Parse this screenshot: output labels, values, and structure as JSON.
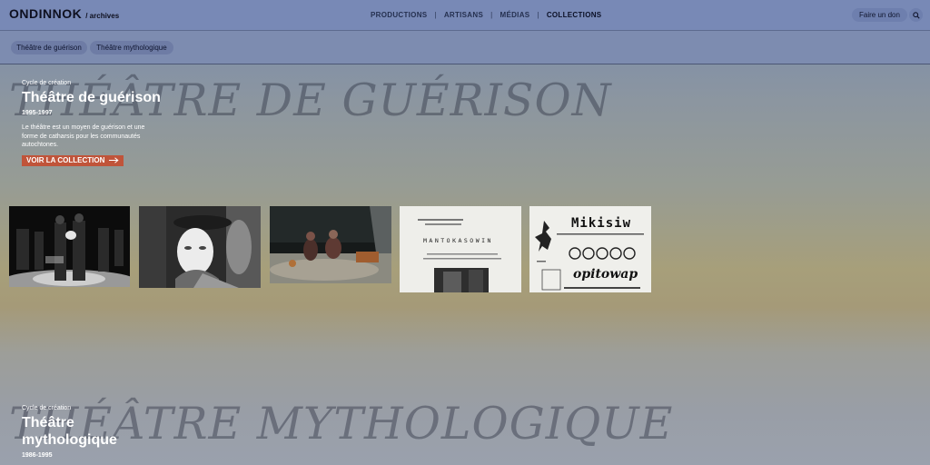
{
  "header": {
    "logo_main": "ONDINNOK",
    "logo_sub": "/ archives",
    "nav": [
      {
        "label": "PRODUCTIONS"
      },
      {
        "label": "ARTISANS"
      },
      {
        "label": "MÉDIAS"
      },
      {
        "label": "COLLECTIONS"
      }
    ],
    "nav_separator": "|",
    "donate_label": "Faire un don",
    "search_icon": "search-icon"
  },
  "filters": [
    "Théâtre de guérison",
    "Théâtre mythologique"
  ],
  "sections": [
    {
      "background_title": "THÉÂTRE DE GUÉRISON",
      "eyebrow": "Cycle de création",
      "title": "Théâtre de guérison",
      "years": "1995-1997",
      "description": "Le théâtre est un moyen de guérison et une forme de catharsis pour les communautés autochtones.",
      "cta": "VOIR LA COLLECTION",
      "cta_icon": "arrow-right-icon",
      "thumbnails": [
        {
          "title": ""
        },
        {
          "title": ""
        },
        {
          "title": ""
        },
        {
          "title": "MANTOKASOWIN"
        },
        {
          "title": "Mikisiw",
          "subtitle": "opitowap"
        }
      ]
    },
    {
      "background_title": "THÉÂTRE MYTHOLOGIQUE",
      "eyebrow": "Cycle de création",
      "title": "Théâtre mythologique",
      "years": "1986-1995"
    }
  ],
  "colors": {
    "topbar": "#7889b6",
    "cta": "#c0543a",
    "text_light": "#ffffff"
  }
}
